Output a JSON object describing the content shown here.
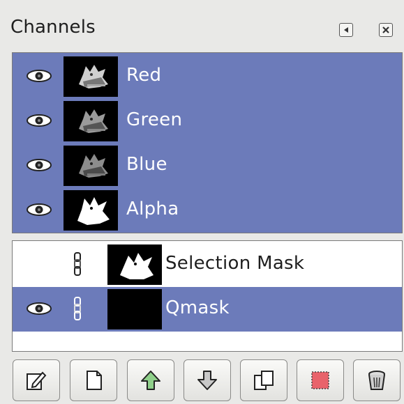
{
  "panel": {
    "title": "Channels"
  },
  "header_buttons": {
    "configure_icon": "tab-menu-icon",
    "close_icon": "close-icon"
  },
  "channels": [
    {
      "name": "Red",
      "visible": true,
      "selected": true,
      "thumb": "wilber-red"
    },
    {
      "name": "Green",
      "visible": true,
      "selected": true,
      "thumb": "wilber-green"
    },
    {
      "name": "Blue",
      "visible": true,
      "selected": true,
      "thumb": "wilber-blue"
    },
    {
      "name": "Alpha",
      "visible": true,
      "selected": true,
      "thumb": "wilber-alpha"
    }
  ],
  "masks": [
    {
      "name": "Selection Mask",
      "visible": false,
      "linked": true,
      "selected": false,
      "thumb": "wilber-mask"
    },
    {
      "name": "Qmask",
      "visible": true,
      "linked": true,
      "selected": true,
      "thumb": "black"
    }
  ],
  "toolbar": [
    {
      "icon": "edit-channel-attributes-icon"
    },
    {
      "icon": "new-channel-icon"
    },
    {
      "icon": "raise-channel-icon"
    },
    {
      "icon": "lower-channel-icon"
    },
    {
      "icon": "duplicate-channel-icon"
    },
    {
      "icon": "channel-to-selection-icon"
    },
    {
      "icon": "delete-channel-icon"
    }
  ],
  "colors": {
    "selected_row": "#6c7bba",
    "background": "#e9e9e7",
    "label_selected": "#ffffff",
    "label_normal": "#1e1e1e"
  }
}
